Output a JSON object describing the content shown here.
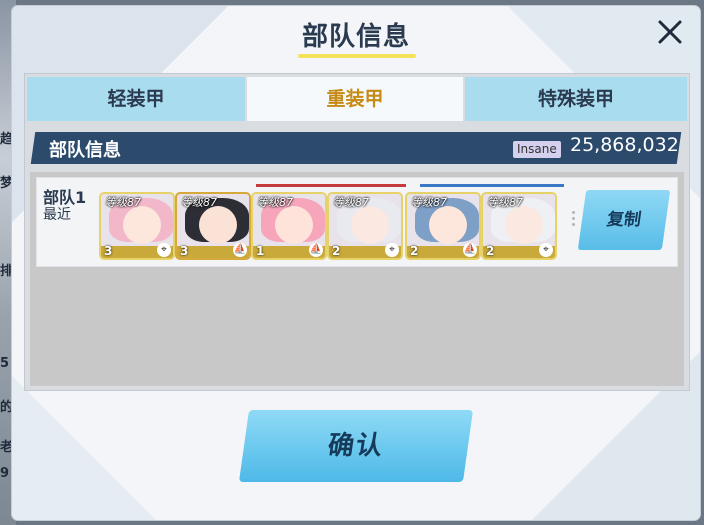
{
  "background_peek": [
    "趋",
    "梦",
    "排",
    "5",
    "的",
    "老",
    "9"
  ],
  "dialog": {
    "title": "部队信息",
    "close_icon": "close-icon"
  },
  "tabs": [
    {
      "label": "轻装甲",
      "active": false
    },
    {
      "label": "重装甲",
      "active": true
    },
    {
      "label": "特殊装甲",
      "active": false
    }
  ],
  "team_header": {
    "label": "部队信息",
    "difficulty_badge": "Insane",
    "power": "25,868,032"
  },
  "teams": [
    {
      "name": "部队1",
      "sub": "最近",
      "members": [
        {
          "level": "等级87",
          "star": "3",
          "hair": "#f2b8c9",
          "border": "#e7d26a"
        },
        {
          "level": "等级87",
          "star": "3",
          "hair": "#2d2d35",
          "border": "#d7a83a"
        },
        {
          "level": "等级87",
          "star": "1",
          "hair": "#f6a5bb",
          "border": "#e7d26a"
        },
        {
          "level": "等级87",
          "star": "2",
          "hair": "#e9eaf0",
          "border": "#e7d26a"
        },
        {
          "level": "等级87",
          "star": "2",
          "hair": "#7fa0c6",
          "border": "#e7d26a"
        },
        {
          "level": "等级87",
          "star": "2",
          "hair": "#eef0f4",
          "border": "#e7d26a"
        }
      ],
      "copy_label": "复制"
    }
  ],
  "confirm_label": "确认",
  "colors": {
    "accent": "#c58b15",
    "header": "#2b4a6c",
    "button": "#58bde8",
    "tab": "#a9dcef"
  }
}
